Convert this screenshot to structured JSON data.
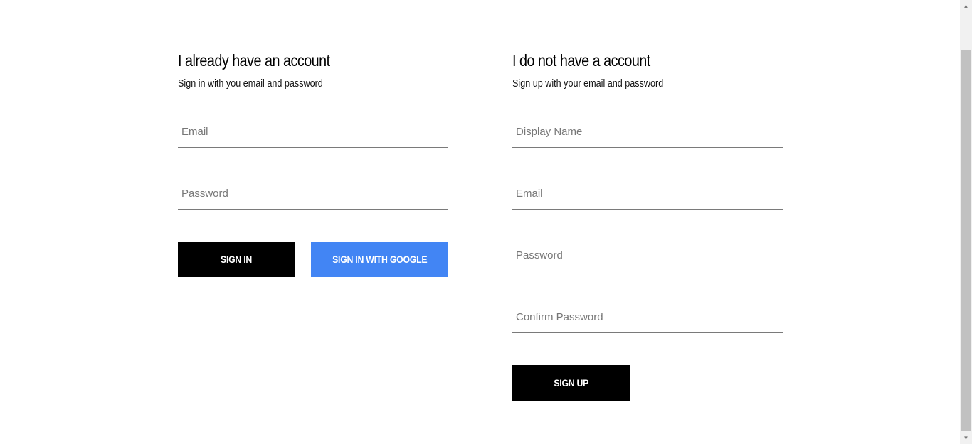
{
  "sign_in": {
    "title": "I already have an account",
    "subtitle": "Sign in with you email and password",
    "fields": {
      "email": {
        "placeholder": "Email",
        "value": ""
      },
      "password": {
        "placeholder": "Password",
        "value": ""
      }
    },
    "buttons": {
      "sign_in": "Sign in",
      "sign_in_google": "Sign in with Google"
    }
  },
  "sign_up": {
    "title": "I do not have a account",
    "subtitle": "Sign up with your email and password",
    "fields": {
      "display_name": {
        "placeholder": "Display Name",
        "value": ""
      },
      "email": {
        "placeholder": "Email",
        "value": ""
      },
      "password": {
        "placeholder": "Password",
        "value": ""
      },
      "confirm_password": {
        "placeholder": "Confirm Password",
        "value": ""
      }
    },
    "buttons": {
      "sign_up": "Sign up"
    }
  },
  "colors": {
    "primary_button": "#000000",
    "google_button": "#4285f4",
    "underline": "#7a7a7a"
  },
  "scrollbar": {
    "up_icon": "triangle-up",
    "down_icon": "triangle-down"
  }
}
